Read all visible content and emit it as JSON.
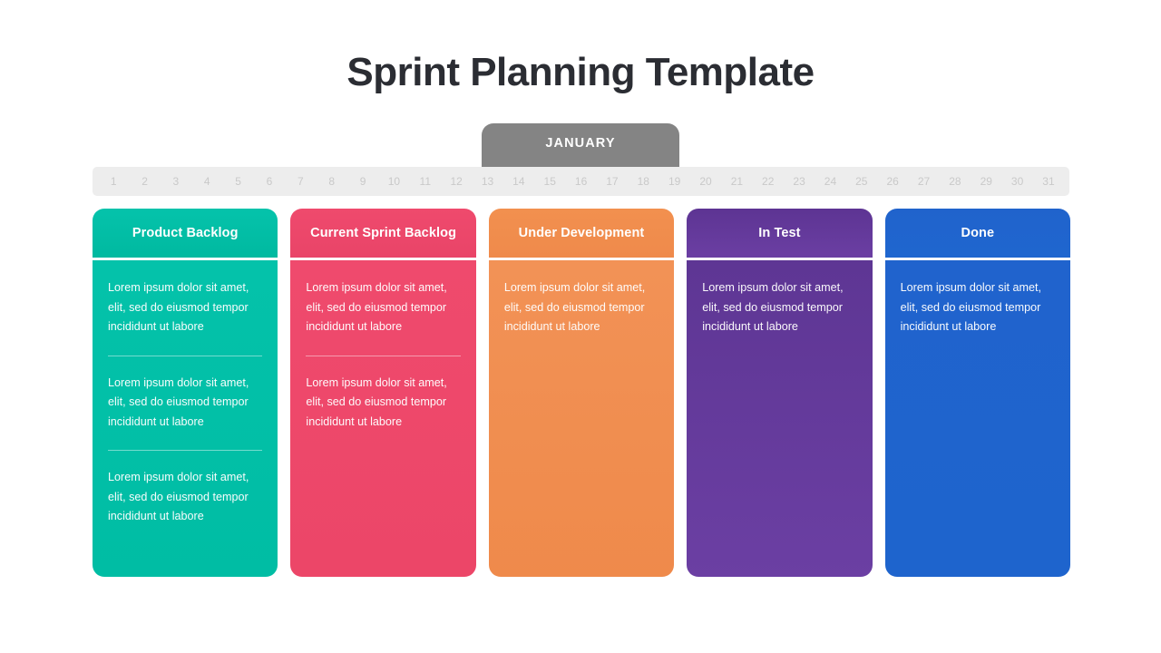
{
  "page": {
    "title": "Sprint Planning Template"
  },
  "timeline": {
    "month_label": "JANUARY",
    "days": [
      "1",
      "2",
      "3",
      "4",
      "5",
      "6",
      "7",
      "8",
      "9",
      "10",
      "11",
      "12",
      "13",
      "14",
      "15",
      "16",
      "17",
      "18",
      "19",
      "20",
      "21",
      "22",
      "23",
      "24",
      "25",
      "26",
      "27",
      "28",
      "29",
      "30",
      "31"
    ]
  },
  "board": {
    "columns": [
      {
        "id": "product-backlog",
        "title": "Product Backlog",
        "color": "#00bfa5",
        "cards": [
          {
            "text": "Lorem ipsum dolor sit amet, elit, sed do eiusmod tempor incididunt ut labore"
          },
          {
            "text": "Lorem ipsum dolor sit amet, elit, sed do eiusmod tempor incididunt ut labore"
          },
          {
            "text": "Lorem ipsum dolor sit amet, elit, sed do eiusmod tempor incididunt ut labore"
          }
        ]
      },
      {
        "id": "current-sprint-backlog",
        "title": "Current Sprint Backlog",
        "color": "#ee4b6a",
        "cards": [
          {
            "text": "Lorem ipsum dolor sit amet, elit, sed do eiusmod tempor incididunt ut labore"
          },
          {
            "text": "Lorem ipsum dolor sit amet, elit, sed do eiusmod tempor incididunt ut labore"
          }
        ]
      },
      {
        "id": "under-development",
        "title": "Under Development",
        "color": "#f0904f",
        "cards": [
          {
            "text": "Lorem ipsum dolor sit amet, elit, sed do eiusmod tempor incididunt ut labore"
          }
        ]
      },
      {
        "id": "in-test",
        "title": "In Test",
        "color": "#5c3596",
        "cards": [
          {
            "text": "Lorem ipsum dolor sit amet, elit, sed do eiusmod tempor incididunt ut labore"
          }
        ]
      },
      {
        "id": "done",
        "title": "Done",
        "color": "#1f66cc",
        "cards": [
          {
            "text": "Lorem ipsum dolor sit amet, elit, sed do eiusmod tempor incididunt ut labore"
          }
        ]
      }
    ]
  }
}
